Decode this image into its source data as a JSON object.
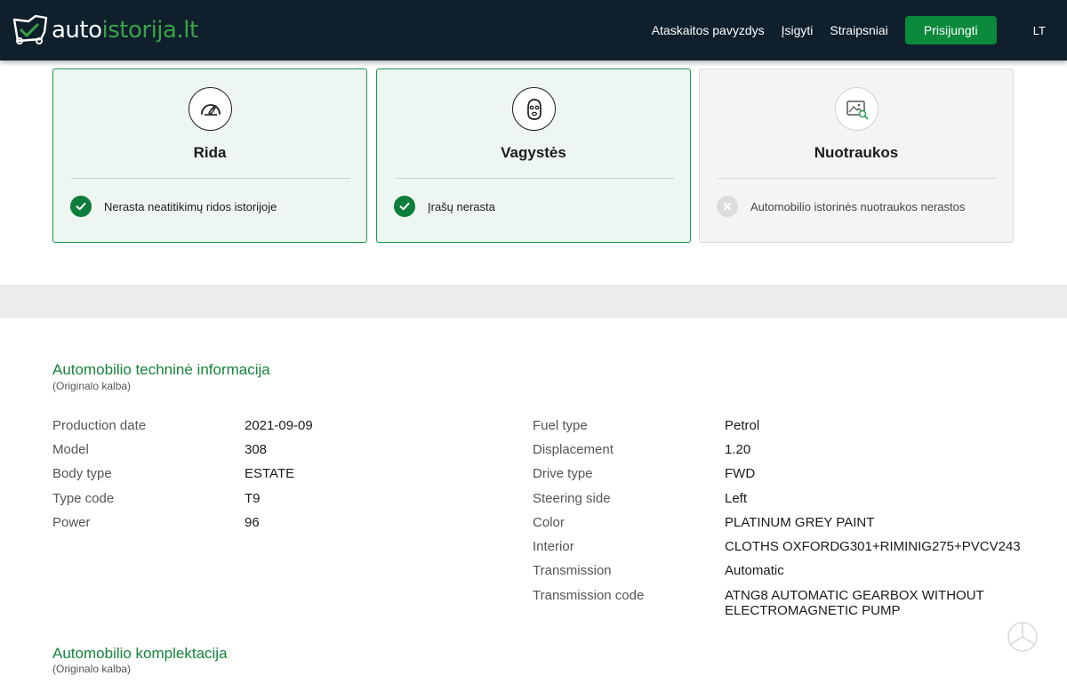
{
  "brand": {
    "part1": "auto",
    "part2": "istorija.lt"
  },
  "nav": {
    "links": [
      "Ataskaitos pavyzdys",
      "Įsigyti",
      "Straipsniai"
    ],
    "login_button": "Prisijungti",
    "language": "LT"
  },
  "cards": [
    {
      "title": "Rida",
      "status": "Nerasta neatitikimų ridos istorijoje",
      "state": "ok",
      "icon": "speedometer-icon"
    },
    {
      "title": "Vagystės",
      "status": "Įrašų nerasta",
      "state": "ok",
      "icon": "thief-mask-icon"
    },
    {
      "title": "Nuotraukos",
      "status": "Automobilio istorinės nuotraukos nerastos",
      "state": "none",
      "icon": "photo-search-icon"
    }
  ],
  "tech": {
    "title": "Automobilio techninė informacija",
    "subtitle": "(Originalo kalba)",
    "left": [
      {
        "label": "Production date",
        "value": "2021-09-09"
      },
      {
        "label": "Model",
        "value": "308"
      },
      {
        "label": "Body type",
        "value": "ESTATE"
      },
      {
        "label": "Type code",
        "value": "T9"
      },
      {
        "label": "Power",
        "value": "96"
      }
    ],
    "right": [
      {
        "label": "Fuel type",
        "value": "Petrol"
      },
      {
        "label": "Displacement",
        "value": "1.20"
      },
      {
        "label": "Drive type",
        "value": "FWD"
      },
      {
        "label": "Steering side",
        "value": "Left"
      },
      {
        "label": "Color",
        "value": "PLATINUM GREY PAINT"
      },
      {
        "label": "Interior",
        "value": "CLOTHS OXFORDG301+RIMINIG275+PVCV243"
      },
      {
        "label": "Transmission",
        "value": "Automatic"
      },
      {
        "label": "Transmission code",
        "value": "ATNG8 AUTOMATIC GEARBOX WITHOUT ELECTROMAGNETIC PUMP"
      }
    ]
  },
  "equipment": {
    "title": "Automobilio komplektacija",
    "subtitle": "(Originalo kalba)"
  },
  "colors": {
    "header": "#0f1f2b",
    "accent": "#39a348",
    "button": "#0b8a3b",
    "ok": "#0c7d3a"
  }
}
